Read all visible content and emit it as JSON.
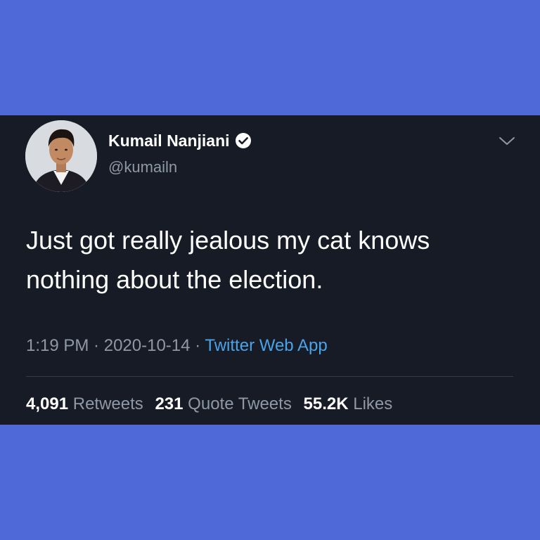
{
  "page": {
    "background_color": "#4f69d9",
    "card_color": "#161b25"
  },
  "tweet": {
    "author": {
      "name": "Kumail Nanjiani",
      "handle": "@kumailn",
      "verified": true,
      "avatar_icon": "profile-photo"
    },
    "menu_icon": "chevron-down-icon",
    "text": "Just got really jealous my cat knows nothing about the election.",
    "meta": {
      "time": "1:19 PM",
      "separator": " · ",
      "date": "2020-10-14",
      "source": "Twitter Web App",
      "source_color": "#4aa3e8"
    },
    "stats": {
      "retweets_count": "4,091",
      "retweets_label": "Retweets",
      "quotes_count": "231",
      "quotes_label": "Quote Tweets",
      "likes_count": "55.2K",
      "likes_label": "Likes"
    }
  }
}
